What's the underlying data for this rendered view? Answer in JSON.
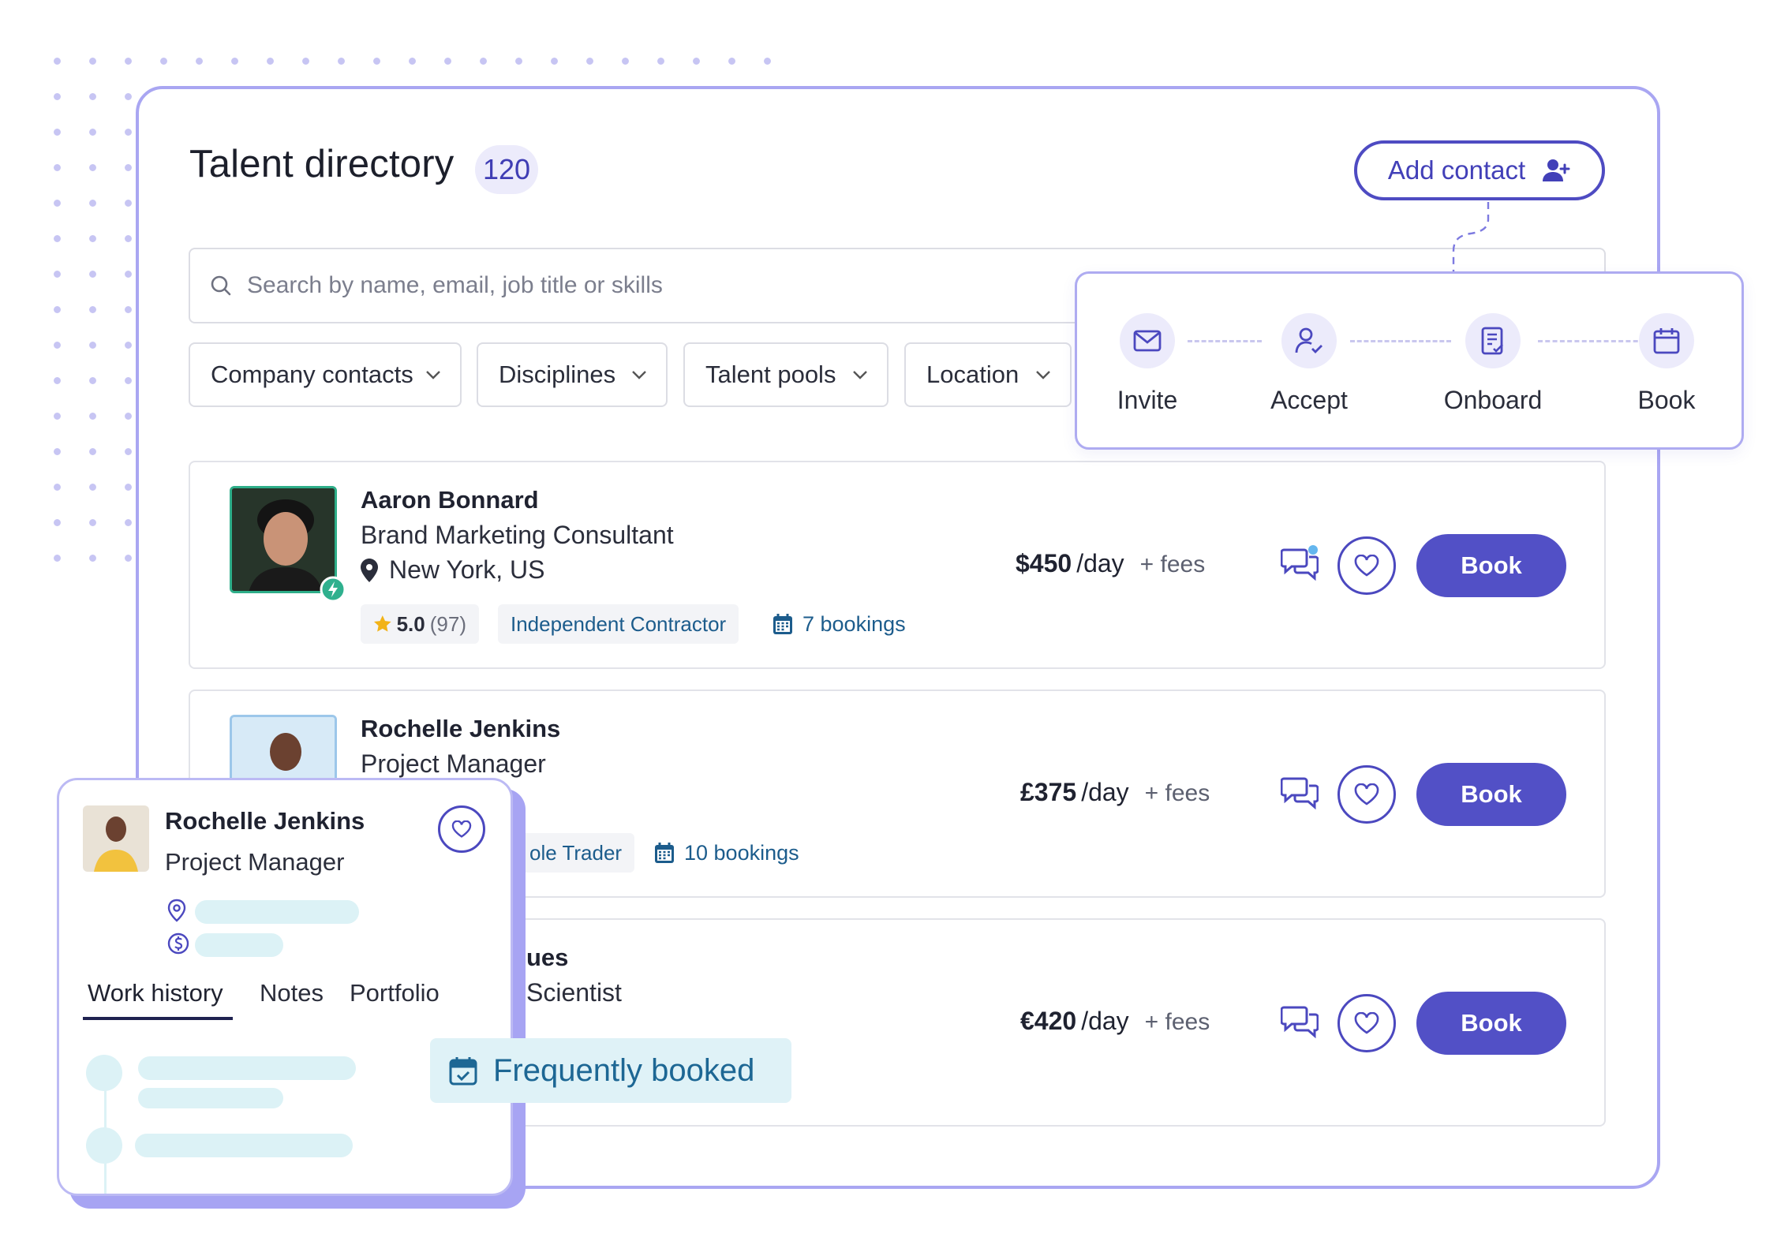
{
  "header": {
    "title": "Talent directory",
    "count": "120",
    "add_contact_label": "Add contact"
  },
  "search": {
    "placeholder": "Search by name, email, job title or skills"
  },
  "filters": [
    "Company contacts",
    "Disciplines",
    "Talent pools",
    "Location"
  ],
  "flow": {
    "steps": [
      "Invite",
      "Accept",
      "Onboard",
      "Book"
    ]
  },
  "talent": [
    {
      "name": "Aaron Bonnard",
      "role": "Brand Marketing Consultant",
      "location": "New York, US",
      "rating": "5.0",
      "rating_count": "(97)",
      "contract": "Independent Contractor",
      "bookings": "7 bookings",
      "price": "$450",
      "per": "/day",
      "fees": "+ fees",
      "book_label": "Book"
    },
    {
      "name": "Rochelle Jenkins",
      "role": "Project Manager",
      "contract_partial": "ole Trader",
      "bookings": "10 bookings",
      "price": "£375",
      "per": "/day",
      "fees": "+ fees",
      "book_label": "Book"
    },
    {
      "name_partial": "ues",
      "role_partial": "Scientist",
      "price": "€420",
      "per": "/day",
      "fees": "+ fees",
      "book_label": "Book"
    }
  ],
  "profile_popup": {
    "name": "Rochelle Jenkins",
    "role": "Project Manager",
    "tabs": [
      "Work history",
      "Notes",
      "Portfolio"
    ]
  },
  "badge": {
    "label": "Frequently booked"
  },
  "colors": {
    "primary": "#5250c6",
    "accent_border": "#a9a6f2",
    "teal_chip": "#dff2f7",
    "link_blue": "#1c5c8c"
  },
  "icons": [
    "search-icon",
    "add-person-icon",
    "chevron-down-icon",
    "mail-icon",
    "user-check-icon",
    "document-icon",
    "calendar-icon",
    "location-pin-icon",
    "star-icon",
    "chat-icon",
    "heart-icon",
    "dollar-icon",
    "lightning-icon"
  ]
}
